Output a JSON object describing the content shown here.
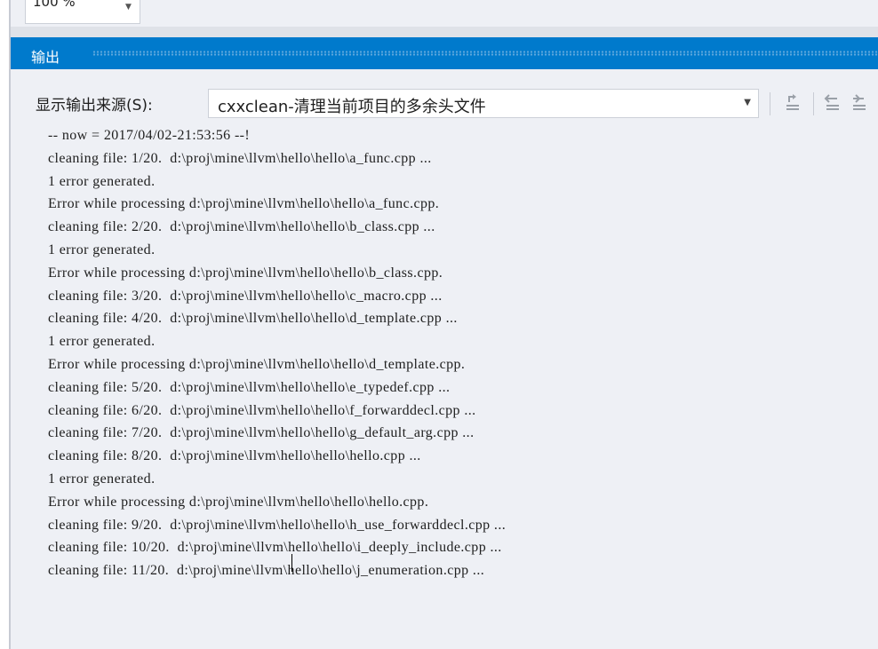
{
  "zoom": {
    "value": "100 %"
  },
  "output_panel": {
    "title": "输出",
    "source_label": "显示输出来源(S):",
    "source_value": "cxxclean-清理当前项目的多余头文件",
    "lines": [
      "-- now = 2017/04/02-21:53:56 --!",
      "cleaning file: 1/20.  d:\\proj\\mine\\llvm\\hello\\hello\\a_func.cpp ...",
      "1 error generated.",
      "Error while processing d:\\proj\\mine\\llvm\\hello\\hello\\a_func.cpp.",
      "cleaning file: 2/20.  d:\\proj\\mine\\llvm\\hello\\hello\\b_class.cpp ...",
      "1 error generated.",
      "Error while processing d:\\proj\\mine\\llvm\\hello\\hello\\b_class.cpp.",
      "cleaning file: 3/20.  d:\\proj\\mine\\llvm\\hello\\hello\\c_macro.cpp ...",
      "cleaning file: 4/20.  d:\\proj\\mine\\llvm\\hello\\hello\\d_template.cpp ...",
      "1 error generated.",
      "Error while processing d:\\proj\\mine\\llvm\\hello\\hello\\d_template.cpp.",
      "cleaning file: 5/20.  d:\\proj\\mine\\llvm\\hello\\hello\\e_typedef.cpp ...",
      "cleaning file: 6/20.  d:\\proj\\mine\\llvm\\hello\\hello\\f_forwarddecl.cpp ...",
      "cleaning file: 7/20.  d:\\proj\\mine\\llvm\\hello\\hello\\g_default_arg.cpp ...",
      "cleaning file: 8/20.  d:\\proj\\mine\\llvm\\hello\\hello\\hello.cpp ...",
      "1 error generated.",
      "Error while processing d:\\proj\\mine\\llvm\\hello\\hello\\hello.cpp.",
      "cleaning file: 9/20.  d:\\proj\\mine\\llvm\\hello\\hello\\h_use_forwarddecl.cpp ...",
      "cleaning file: 10/20.  d:\\proj\\mine\\llvm\\hello\\hello\\i_deeply_include.cpp ...",
      "cleaning file: 11/20.  d:\\proj\\mine\\llvm\\hello\\hello\\j_enumeration.cpp ..."
    ]
  },
  "colors": {
    "accent": "#007acc",
    "panel_bg": "#eef0f5",
    "text": "#1e1e1e"
  },
  "icons": [
    "find-message-in-code-icon",
    "go-to-previous-message-icon",
    "go-to-next-message-icon"
  ]
}
